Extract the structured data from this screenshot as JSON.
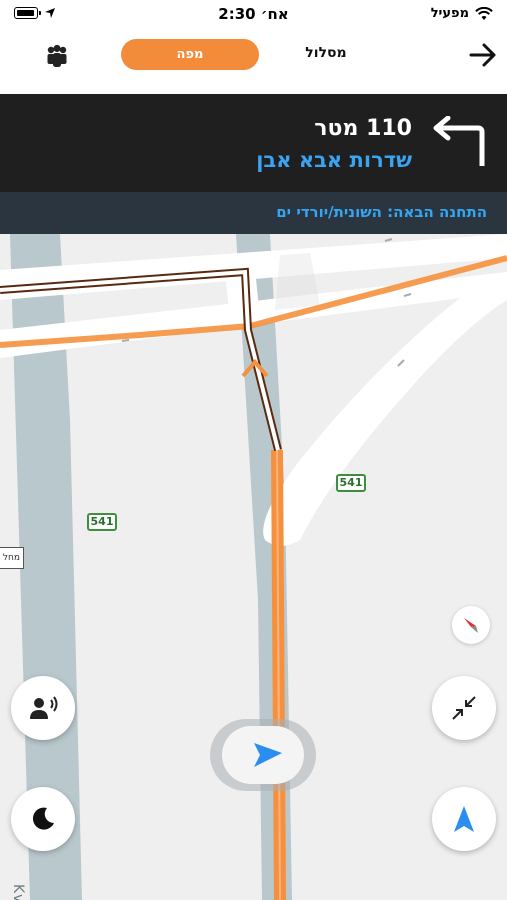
{
  "status_bar": {
    "time": "2:30 אח׳",
    "carrier": "מפעיל"
  },
  "nav": {
    "map_tab": "מפה",
    "route_tab": "מסלול"
  },
  "instruction": {
    "distance": "110 מטר",
    "street": "שדרות אבא אבן",
    "maneuver": "turn-left"
  },
  "next_stop": {
    "text": "התחנה הבאה: השונית/יורדי ים"
  },
  "map": {
    "street_label": "Kvish H",
    "road_shields": [
      "541",
      "541"
    ],
    "sign_text": "מחל"
  },
  "colors": {
    "accent": "#f28c3b",
    "route": "#f5913e",
    "link": "#3aa4f0",
    "banner": "#1f1f1f",
    "next_stop_bg": "#2b3540"
  }
}
